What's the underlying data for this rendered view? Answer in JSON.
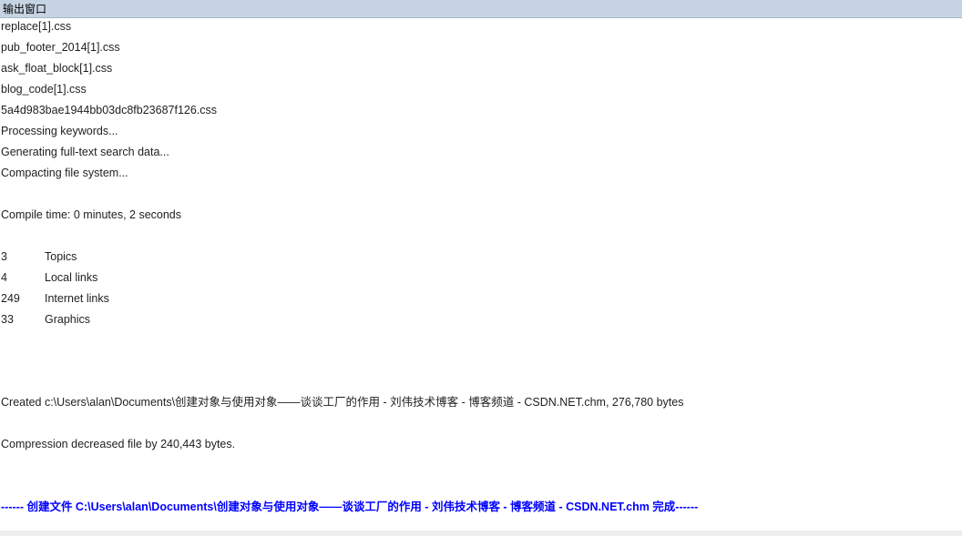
{
  "window": {
    "title": "输出窗口"
  },
  "colors": {
    "titlebar": "#c6d3e3",
    "final_line": "#0000ff",
    "text": "#1e1e1e"
  },
  "output": {
    "files": [
      "replace[1].css",
      "pub_footer_2014[1].css",
      "ask_float_block[1].css",
      "blog_code[1].css",
      "5a4d983bae1944bb03dc8fb23687f126.css"
    ],
    "progress": [
      "Processing keywords...",
      "Generating full-text search data...",
      "Compacting file system..."
    ],
    "compile_time": "Compile time: 0 minutes, 2 seconds",
    "stats": [
      {
        "count": "3",
        "label": "Topics"
      },
      {
        "count": "4",
        "label": "Local links"
      },
      {
        "count": "249",
        "label": "Internet links"
      },
      {
        "count": "33",
        "label": "Graphics"
      }
    ],
    "created": "Created c:\\Users\\alan\\Documents\\创建对象与使用对象——谈谈工厂的作用 - 刘伟技术博客 - 博客频道 - CSDN.NET.chm, 276,780 bytes",
    "compression": "Compression decreased file by 240,443 bytes.",
    "final": "------ 创建文件 C:\\Users\\alan\\Documents\\创建对象与使用对象——谈谈工厂的作用 - 刘伟技术博客 - 博客频道 - CSDN.NET.chm 完成------"
  }
}
